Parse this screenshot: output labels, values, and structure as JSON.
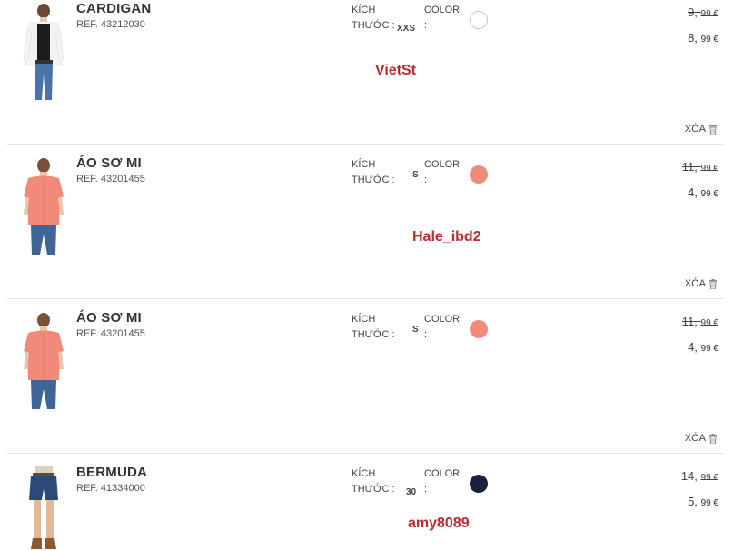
{
  "cart": {
    "delete_label": "XÓA",
    "size_label": "KÍCH THƯỚC :",
    "color_label": "COLOR :",
    "items": [
      {
        "name": "CARDIGAN",
        "ref": "REF. 43212030",
        "size": "XXS",
        "color_hex": "#ffffff",
        "old_price_int": "9,",
        "old_price_dec": "99 €",
        "new_price_int": "8,",
        "new_price_dec": "99 €",
        "watermark": "VietSt",
        "thumb_icon": "cardigan-photo"
      },
      {
        "name": "ÁO SƠ MI",
        "ref": "REF. 43201455",
        "size": "S",
        "color_hex": "#f28a7a",
        "old_price_int": "11,",
        "old_price_dec": "99 €",
        "new_price_int": "4,",
        "new_price_dec": "99 €",
        "watermark": "Hale_ibd2",
        "thumb_icon": "shirt-photo"
      },
      {
        "name": "ÁO SƠ MI",
        "ref": "REF. 43201455",
        "size": "S",
        "color_hex": "#f28a7a",
        "old_price_int": "11,",
        "old_price_dec": "99 €",
        "new_price_int": "4,",
        "new_price_dec": "99 €",
        "watermark": "",
        "thumb_icon": "shirt-photo"
      },
      {
        "name": "BERMUDA",
        "ref": "REF. 41334000",
        "size": "30",
        "color_hex": "#1a1f3d",
        "old_price_int": "14,",
        "old_price_dec": "99 €",
        "new_price_int": "5,",
        "new_price_dec": "99 €",
        "watermark": "amy8089",
        "thumb_icon": "shorts-photo"
      }
    ]
  }
}
